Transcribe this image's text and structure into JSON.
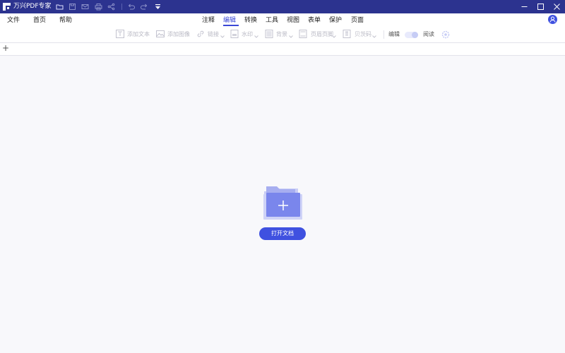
{
  "app": {
    "title": "万兴PDF专家"
  },
  "menu": {
    "file": "文件",
    "home": "首页",
    "help": "帮助"
  },
  "tabs": [
    {
      "label": "注释",
      "active": false
    },
    {
      "label": "编辑",
      "active": true
    },
    {
      "label": "转换",
      "active": false
    },
    {
      "label": "工具",
      "active": false
    },
    {
      "label": "视图",
      "active": false
    },
    {
      "label": "表单",
      "active": false
    },
    {
      "label": "保护",
      "active": false
    },
    {
      "label": "页面",
      "active": false
    }
  ],
  "toolbar": {
    "add_text": "添加文本",
    "add_image": "添加图像",
    "link": "链接",
    "watermark": "水印",
    "background": "背景",
    "header_footer": "页眉页脚",
    "bates": "贝茨码",
    "edit_mode": "编辑",
    "read_mode": "阅读"
  },
  "main": {
    "open_button": "打开文档",
    "new_tab": "+"
  },
  "colors": {
    "titlebar": "#2c338f",
    "accent": "#3f51e0",
    "disabled": "#b9b9c4",
    "canvas": "#f8f8fb"
  },
  "icons": [
    "app-logo-icon",
    "folder-icon",
    "save-icon",
    "mail-icon",
    "print-icon",
    "share-icon",
    "undo-icon",
    "redo-icon",
    "dropdown-icon",
    "minimize-icon",
    "maximize-icon",
    "close-icon",
    "user-icon",
    "text-box-icon",
    "image-icon",
    "link-icon",
    "watermark-icon",
    "background-icon",
    "header-footer-icon",
    "bates-icon",
    "settings-icon",
    "folder-plus-icon"
  ]
}
